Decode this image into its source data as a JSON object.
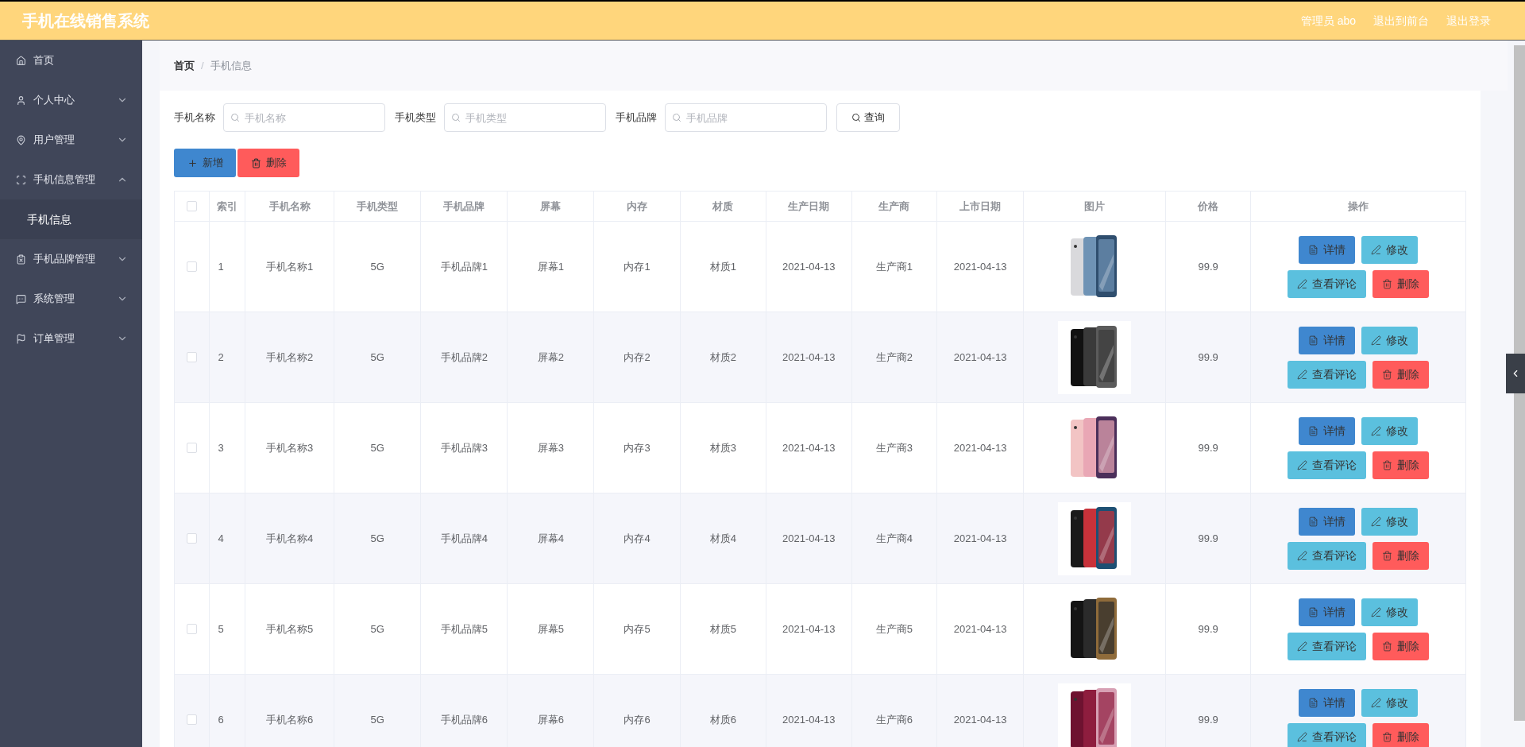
{
  "header": {
    "title": "手机在线销售系统",
    "links": [
      "管理员 abo",
      "退出到前台",
      "退出登录"
    ]
  },
  "sidebar": {
    "items": [
      {
        "label": "首页"
      },
      {
        "label": "个人中心",
        "expanded": false
      },
      {
        "label": "用户管理",
        "expanded": false
      },
      {
        "label": "手机信息管理",
        "expanded": true,
        "children": [
          {
            "label": "手机信息",
            "selected": true
          }
        ]
      },
      {
        "label": "手机品牌管理",
        "expanded": false
      },
      {
        "label": "系统管理",
        "expanded": false
      },
      {
        "label": "订单管理",
        "expanded": false
      }
    ]
  },
  "breadcrumb": {
    "items": [
      "首页",
      "手机信息"
    ],
    "separator": "/"
  },
  "search": {
    "fields": [
      {
        "label": "手机名称",
        "placeholder": "手机名称"
      },
      {
        "label": "手机类型",
        "placeholder": "手机类型"
      },
      {
        "label": "手机品牌",
        "placeholder": "手机品牌"
      }
    ],
    "button": "查询"
  },
  "toolbar": [
    {
      "kind": "add",
      "label": "新增"
    },
    {
      "kind": "delete",
      "label": "删除"
    }
  ],
  "table": {
    "select_all": {
      "checked": false
    },
    "columns": [
      "索引",
      "手机名称",
      "手机类型",
      "手机品牌",
      "屏幕",
      "内存",
      "材质",
      "生产日期",
      "生产商",
      "上市日期",
      "图片",
      "价格",
      "操作"
    ],
    "rows": [
      {
        "checked": false,
        "cells": [
          "1",
          "手机名称1",
          "5G",
          "手机品牌1",
          "屏幕1",
          "内存1",
          "材质1",
          "2021-04-13",
          "生产商1",
          "2021-04-13"
        ],
        "price": "99.9",
        "actions": [
          {
            "kind": "detail",
            "label": "详情"
          },
          {
            "kind": "edit",
            "label": "修改"
          },
          {
            "kind": "comments",
            "label": "查看评论"
          },
          {
            "kind": "delete",
            "label": "删除"
          }
        ]
      },
      {
        "checked": false,
        "cells": [
          "2",
          "手机名称2",
          "5G",
          "手机品牌2",
          "屏幕2",
          "内存2",
          "材质2",
          "2021-04-13",
          "生产商2",
          "2021-04-13"
        ],
        "price": "99.9",
        "actions": [
          {
            "kind": "detail",
            "label": "详情"
          },
          {
            "kind": "edit",
            "label": "修改"
          },
          {
            "kind": "comments",
            "label": "查看评论"
          },
          {
            "kind": "delete",
            "label": "删除"
          }
        ]
      },
      {
        "checked": false,
        "cells": [
          "3",
          "手机名称3",
          "5G",
          "手机品牌3",
          "屏幕3",
          "内存3",
          "材质3",
          "2021-04-13",
          "生产商3",
          "2021-04-13"
        ],
        "price": "99.9",
        "actions": [
          {
            "kind": "detail",
            "label": "详情"
          },
          {
            "kind": "edit",
            "label": "修改"
          },
          {
            "kind": "comments",
            "label": "查看评论"
          },
          {
            "kind": "delete",
            "label": "删除"
          }
        ]
      },
      {
        "checked": false,
        "cells": [
          "4",
          "手机名称4",
          "5G",
          "手机品牌4",
          "屏幕4",
          "内存4",
          "材质4",
          "2021-04-13",
          "生产商4",
          "2021-04-13"
        ],
        "price": "99.9",
        "actions": [
          {
            "kind": "detail",
            "label": "详情"
          },
          {
            "kind": "edit",
            "label": "修改"
          },
          {
            "kind": "comments",
            "label": "查看评论"
          },
          {
            "kind": "delete",
            "label": "删除"
          }
        ]
      },
      {
        "checked": false,
        "cells": [
          "5",
          "手机名称5",
          "5G",
          "手机品牌5",
          "屏幕5",
          "内存5",
          "材质5",
          "2021-04-13",
          "生产商5",
          "2021-04-13"
        ],
        "price": "99.9",
        "actions": [
          {
            "kind": "detail",
            "label": "详情"
          },
          {
            "kind": "edit",
            "label": "修改"
          },
          {
            "kind": "comments",
            "label": "查看评论"
          },
          {
            "kind": "delete",
            "label": "删除"
          }
        ]
      },
      {
        "checked": false,
        "cells": [
          "6",
          "手机名称6",
          "5G",
          "手机品牌6",
          "屏幕6",
          "内存6",
          "材质6",
          "2021-04-13",
          "生产商6",
          "2021-04-13"
        ],
        "price": "99.9",
        "actions": [
          {
            "kind": "detail",
            "label": "详情"
          },
          {
            "kind": "edit",
            "label": "修改"
          },
          {
            "kind": "comments",
            "label": "查看评论"
          },
          {
            "kind": "delete",
            "label": "删除"
          }
        ]
      }
    ]
  }
}
